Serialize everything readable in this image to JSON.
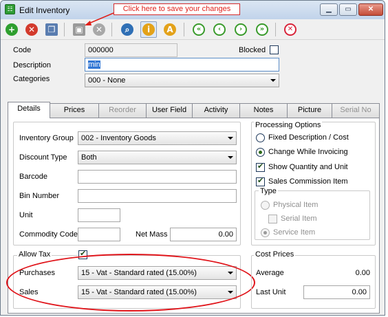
{
  "window": {
    "title": "Edit Inventory",
    "app_icon_glyph": "☷"
  },
  "callout": {
    "text": "Click here to save your changes",
    "color": "#e0201a"
  },
  "toolbar": {
    "buttons": [
      {
        "name": "add-icon",
        "glyph": "+",
        "color": "#2f9f2f"
      },
      {
        "name": "delete-icon",
        "glyph": "✕",
        "color": "#d33a2c"
      },
      {
        "name": "copy-icon",
        "glyph": "❐",
        "color": "#5a7db0"
      },
      {
        "name": "save-icon",
        "glyph": "▣",
        "color": "#9a9a9a"
      },
      {
        "name": "cancel-icon",
        "glyph": "⊗",
        "color": "#a8a8a8"
      },
      {
        "name": "search-icon",
        "glyph": "⌕",
        "color": "#2f6fb5"
      },
      {
        "name": "item-info-icon",
        "glyph": "i",
        "color": "#e3a21a"
      },
      {
        "name": "item-alpha-icon",
        "glyph": "A",
        "color": "#e3a21a"
      },
      {
        "name": "first-record-icon",
        "glyph": "|◀",
        "color": "#3a9b2c"
      },
      {
        "name": "previous-record-icon",
        "glyph": "◀",
        "color": "#3a9b2c"
      },
      {
        "name": "next-record-icon",
        "glyph": "▶",
        "color": "#3a9b2c"
      },
      {
        "name": "last-record-icon",
        "glyph": "▶|",
        "color": "#3a9b2c"
      },
      {
        "name": "close-record-icon",
        "glyph": "✕",
        "color": "#d8243a"
      }
    ]
  },
  "header": {
    "code_label": "Code",
    "code_value": "000000",
    "blocked_label": "Blocked",
    "description_label": "Description",
    "description_value": "min",
    "categories_label": "Categories",
    "categories_value": "000 - None"
  },
  "tabs": [
    {
      "label": "Details",
      "state": "active"
    },
    {
      "label": "Prices",
      "state": "normal"
    },
    {
      "label": "Reorder",
      "state": "disabled"
    },
    {
      "label": "User Field",
      "state": "normal"
    },
    {
      "label": "Activity",
      "state": "normal"
    },
    {
      "label": "Notes",
      "state": "normal"
    },
    {
      "label": "Picture",
      "state": "normal"
    },
    {
      "label": "Serial No",
      "state": "disabled"
    }
  ],
  "details": {
    "inventory_group_label": "Inventory Group",
    "inventory_group_value": "002 - Inventory Goods",
    "discount_type_label": "Discount Type",
    "discount_type_value": "Both",
    "barcode_label": "Barcode",
    "barcode_value": "",
    "bin_number_label": "Bin Number",
    "bin_number_value": "",
    "unit_label": "Unit",
    "unit_value": "",
    "commodity_code_label": "Commodity Code",
    "commodity_code_value": "",
    "net_mass_label": "Net Mass",
    "net_mass_value": "0.00"
  },
  "processing": {
    "title": "Processing Options",
    "fixed_description": "Fixed Description / Cost",
    "change_while_invoicing": "Change While Invoicing",
    "show_quantity": "Show Quantity and Unit",
    "sales_commission": "Sales Commission Item",
    "type_title": "Type",
    "physical_item": "Physical Item",
    "serial_item": "Serial Item",
    "service_item": "Service Item"
  },
  "tax": {
    "allow_tax_label": "Allow Tax",
    "purchases_label": "Purchases",
    "purchases_value": "15 - Vat - Standard rated (15.00%)",
    "sales_label": "Sales",
    "sales_value": "15 - Vat - Standard rated (15.00%)"
  },
  "cost": {
    "title": "Cost Prices",
    "average_label": "Average",
    "average_value": "0.00",
    "last_unit_label": "Last Unit",
    "last_unit_value": "0.00"
  }
}
